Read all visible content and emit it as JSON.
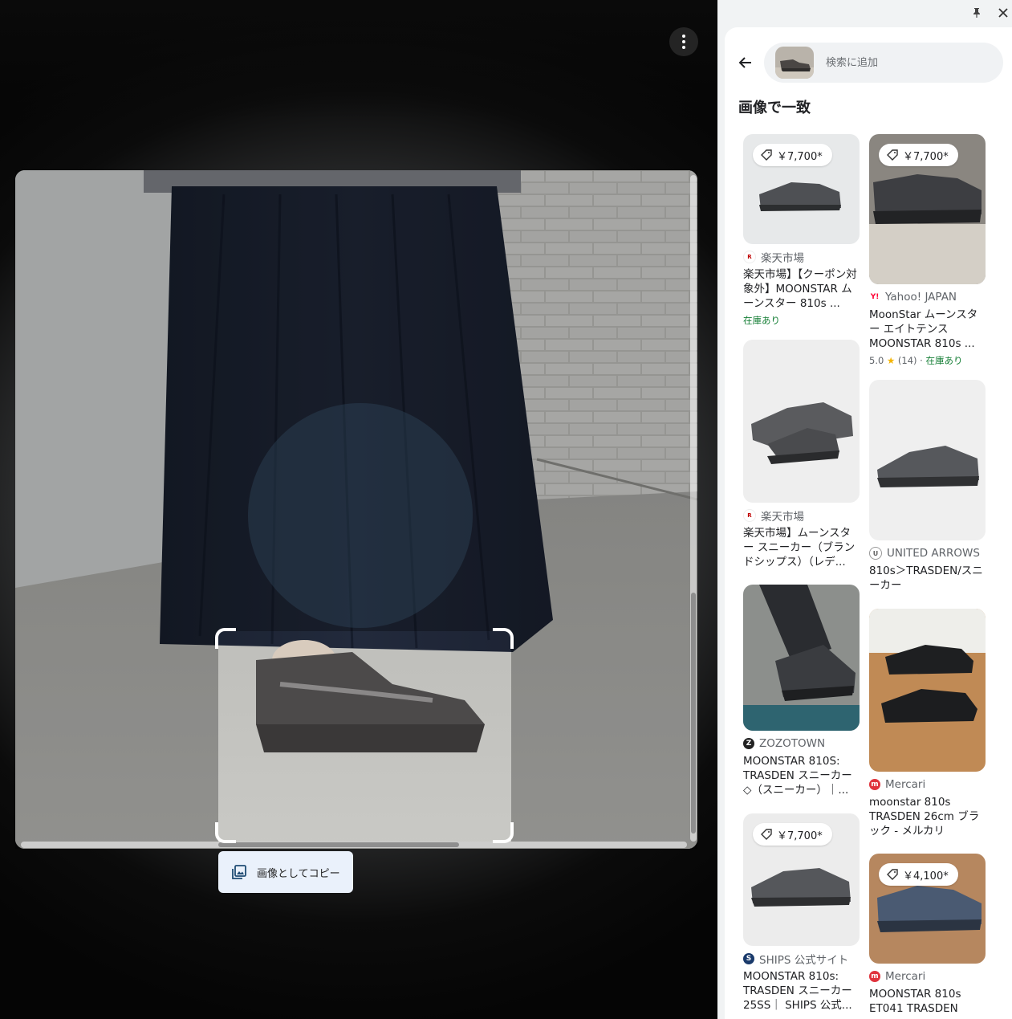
{
  "viewer": {
    "more_icon": "more-vert-icon",
    "copy_button_label": "画像としてコピー",
    "copy_icon": "image-copy-icon"
  },
  "panel": {
    "pin_icon": "pin-icon",
    "close_icon": "close-icon",
    "back_icon": "arrow-back-icon",
    "search_placeholder": "検索に追加",
    "heading": "画像で一致",
    "tag_icon": "price-tag-icon",
    "results_col1": [
      {
        "price": "￥7,700*",
        "source": "楽天市場",
        "title": "楽天市場】【クーポン対象外】MOONSTAR ムーンスター 810s ...",
        "stock": "在庫あり",
        "fav_color": "#bf0000"
      },
      {
        "price": "",
        "source": "楽天市場",
        "title": "楽天市場】ムーンスター スニーカー（ブランドシップス）（レデ...",
        "stock": "",
        "fav_color": "#bf0000"
      },
      {
        "price": "",
        "source": "ZOZOTOWN",
        "title": "MOONSTAR 810S: TRASDEN スニーカー◇（スニーカー）｜...",
        "stock": "",
        "fav_color": "#222222"
      },
      {
        "price": "￥7,700*",
        "source": "SHIPS 公式サイト",
        "title": "MOONSTAR 810s: TRASDEN スニーカー 25SS｜ SHIPS 公式...",
        "stock": "",
        "fav_color": "#1a3a6b"
      }
    ],
    "results_col2": [
      {
        "price": "￥7,700*",
        "source": "Yahoo! JAPAN",
        "title": "MoonStar ムーンスター エイトテンス MOONSTAR 810s ...",
        "rating_value": "5.0",
        "rating_star": "★",
        "rating_count": "(14)",
        "rating_stock": "在庫あり",
        "fav_color": "#ff0033"
      },
      {
        "price": "",
        "source": "UNITED ARROWS",
        "title": "810s＞TRASDEN/スニーカー",
        "fav_color": "#666666"
      },
      {
        "price": "",
        "source": "Mercari",
        "title": "moonstar 810s TRASDEN 26cm ブラック - メルカリ",
        "fav_color": "#e0323c"
      },
      {
        "price": "￥4,100*",
        "source": "Mercari",
        "title": "MOONSTAR 810s ET041 TRASDEN",
        "fav_color": "#e0323c"
      }
    ]
  }
}
